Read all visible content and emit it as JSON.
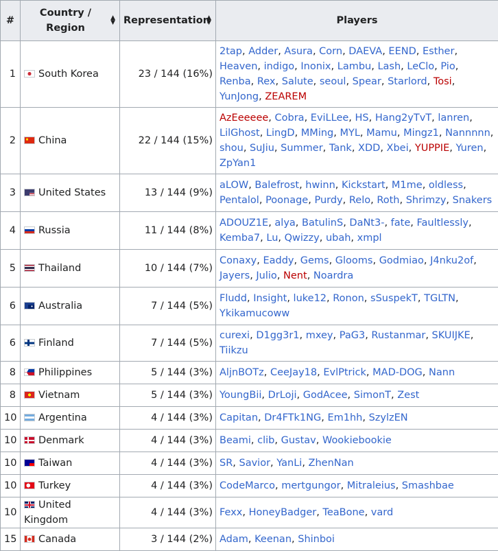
{
  "headers": {
    "rank": "#",
    "country": "Country / Region",
    "representation": "Representation",
    "players": "Players"
  },
  "colors": {
    "link": "#3366cc",
    "redlink": "#ba0000",
    "header_bg": "#eaecf0",
    "border": "#a2a9b1"
  },
  "rows": [
    {
      "rank": "1",
      "country": "South Korea",
      "flag": "kr",
      "rep": "23 / 144 (16%)",
      "h": 76,
      "players": [
        {
          "n": "2tap"
        },
        {
          "n": "Adder"
        },
        {
          "n": "Asura"
        },
        {
          "n": "Corn"
        },
        {
          "n": "DAEVA"
        },
        {
          "n": "EEND"
        },
        {
          "n": "Esther"
        },
        {
          "n": "Heaven"
        },
        {
          "n": "indigo"
        },
        {
          "n": "Inonix"
        },
        {
          "n": "Lambu"
        },
        {
          "n": "Lash"
        },
        {
          "n": "LeClo"
        },
        {
          "n": "Pio"
        },
        {
          "n": "Renba"
        },
        {
          "n": "Rex"
        },
        {
          "n": "Salute"
        },
        {
          "n": "seoul"
        },
        {
          "n": "Spear"
        },
        {
          "n": "Starlord"
        },
        {
          "n": "Tosi",
          "red": true
        },
        {
          "n": "YunJong"
        },
        {
          "n": "ZEAREM",
          "red": true
        }
      ]
    },
    {
      "rank": "2",
      "country": "China",
      "flag": "cn",
      "rep": "22 / 144 (15%)",
      "h": 77,
      "players": [
        {
          "n": "AzEeeeee",
          "red": true
        },
        {
          "n": "Cobra"
        },
        {
          "n": "EviLLee"
        },
        {
          "n": "HS"
        },
        {
          "n": "Hang2yTvT"
        },
        {
          "n": "lanren"
        },
        {
          "n": "LilGhost"
        },
        {
          "n": "LingD"
        },
        {
          "n": "MMing"
        },
        {
          "n": "MYL"
        },
        {
          "n": "Mamu"
        },
        {
          "n": "Mingz1"
        },
        {
          "n": "Nannnnn"
        },
        {
          "n": "shou"
        },
        {
          "n": "SuJiu"
        },
        {
          "n": "Summer"
        },
        {
          "n": "Tank"
        },
        {
          "n": "XDD"
        },
        {
          "n": "Xbei"
        },
        {
          "n": "YUPPIE",
          "red": true
        },
        {
          "n": "Yuren"
        },
        {
          "n": "ZpYan1"
        }
      ]
    },
    {
      "rank": "3",
      "country": "United States",
      "flag": "us",
      "rep": "13 / 144 (9%)",
      "h": 55,
      "players": [
        {
          "n": "aLOW"
        },
        {
          "n": "Balefrost"
        },
        {
          "n": "hwinn"
        },
        {
          "n": "Kickstart"
        },
        {
          "n": "M1me"
        },
        {
          "n": "oldless"
        },
        {
          "n": "Pentalol"
        },
        {
          "n": "Poonage"
        },
        {
          "n": "Purdy"
        },
        {
          "n": "Relo"
        },
        {
          "n": "Roth"
        },
        {
          "n": "Shrimzy"
        },
        {
          "n": "Snakers"
        }
      ]
    },
    {
      "rank": "4",
      "country": "Russia",
      "flag": "ru",
      "rep": "11 / 144 (8%)",
      "h": 55,
      "players": [
        {
          "n": "ADOUZ1E"
        },
        {
          "n": "alya"
        },
        {
          "n": "BatulinS"
        },
        {
          "n": "DaNt3-"
        },
        {
          "n": "fate"
        },
        {
          "n": "Faultlessly"
        },
        {
          "n": "Kemba7"
        },
        {
          "n": "Lu"
        },
        {
          "n": "Qwizzy"
        },
        {
          "n": "ubah"
        },
        {
          "n": "xmpl"
        }
      ]
    },
    {
      "rank": "5",
      "country": "Thailand",
      "flag": "th",
      "rep": "10 / 144 (7%)",
      "h": 55,
      "players": [
        {
          "n": "Conaxy"
        },
        {
          "n": "Eaddy"
        },
        {
          "n": "Gems"
        },
        {
          "n": "Glooms"
        },
        {
          "n": "Godmiao"
        },
        {
          "n": "J4nku2of"
        },
        {
          "n": "Jayers"
        },
        {
          "n": "Julio"
        },
        {
          "n": "Nent",
          "red": true
        },
        {
          "n": "Noardra"
        }
      ]
    },
    {
      "rank": "6",
      "country": "Australia",
      "flag": "au",
      "rep": "7 / 144 (5%)",
      "h": 55,
      "players": [
        {
          "n": "Fludd"
        },
        {
          "n": "Insight"
        },
        {
          "n": "luke12"
        },
        {
          "n": "Ronon"
        },
        {
          "n": "sSuspekT"
        },
        {
          "n": "TGLTN"
        },
        {
          "n": "Ykikamucoww"
        }
      ]
    },
    {
      "rank": "6",
      "country": "Finland",
      "flag": "fi",
      "rep": "7 / 144 (5%)",
      "h": 33,
      "players": [
        {
          "n": "curexi"
        },
        {
          "n": "D1gg3r1"
        },
        {
          "n": "mxey"
        },
        {
          "n": "PaG3"
        },
        {
          "n": "Rustanmar"
        },
        {
          "n": "SKUIJKE"
        },
        {
          "n": "Tiikzu"
        }
      ]
    },
    {
      "rank": "8",
      "country": "Philippines",
      "flag": "ph",
      "rep": "5 / 144 (3%)",
      "h": 33,
      "players": [
        {
          "n": "AljnBOTz"
        },
        {
          "n": "CeeJay18"
        },
        {
          "n": "EvlPtrick"
        },
        {
          "n": "MAD-DOG"
        },
        {
          "n": "Nann"
        }
      ]
    },
    {
      "rank": "8",
      "country": "Vietnam",
      "flag": "vn",
      "rep": "5 / 144 (3%)",
      "h": 33,
      "players": [
        {
          "n": "YoungBii"
        },
        {
          "n": "DrLoji"
        },
        {
          "n": "GodAcee"
        },
        {
          "n": "SimonT"
        },
        {
          "n": "Zest"
        }
      ]
    },
    {
      "rank": "10",
      "country": "Argentina",
      "flag": "ar",
      "rep": "4 / 144 (3%)",
      "h": 33,
      "players": [
        {
          "n": "Capitan"
        },
        {
          "n": "Dr4FTk1NG"
        },
        {
          "n": "Em1hh"
        },
        {
          "n": "SzylzEN"
        }
      ]
    },
    {
      "rank": "10",
      "country": "Denmark",
      "flag": "dk",
      "rep": "4 / 144 (3%)",
      "h": 33,
      "players": [
        {
          "n": "Beami"
        },
        {
          "n": "clib"
        },
        {
          "n": "Gustav"
        },
        {
          "n": "Wookiebookie"
        }
      ]
    },
    {
      "rank": "10",
      "country": "Taiwan",
      "flag": "tw",
      "rep": "4 / 144 (3%)",
      "h": 33,
      "players": [
        {
          "n": "SR"
        },
        {
          "n": "Savior"
        },
        {
          "n": "YanLi"
        },
        {
          "n": "ZhenNan"
        }
      ]
    },
    {
      "rank": "10",
      "country": "Turkey",
      "flag": "tr",
      "rep": "4 / 144 (3%)",
      "h": 33,
      "players": [
        {
          "n": "CodeMarco"
        },
        {
          "n": "mertgungor"
        },
        {
          "n": "Mitraleius"
        },
        {
          "n": "Smashbae"
        }
      ]
    },
    {
      "rank": "10",
      "country": "United Kingdom",
      "flag": "gb",
      "rep": "4 / 144 (3%)",
      "h": 33,
      "players": [
        {
          "n": "Fexx"
        },
        {
          "n": "HoneyBadger"
        },
        {
          "n": "TeaBone"
        },
        {
          "n": "vard"
        }
      ]
    },
    {
      "rank": "15",
      "country": "Canada",
      "flag": "ca",
      "rep": "3 / 144 (2%)",
      "h": 33,
      "players": [
        {
          "n": "Adam"
        },
        {
          "n": "Keenan"
        },
        {
          "n": "Shinboi"
        }
      ]
    }
  ]
}
